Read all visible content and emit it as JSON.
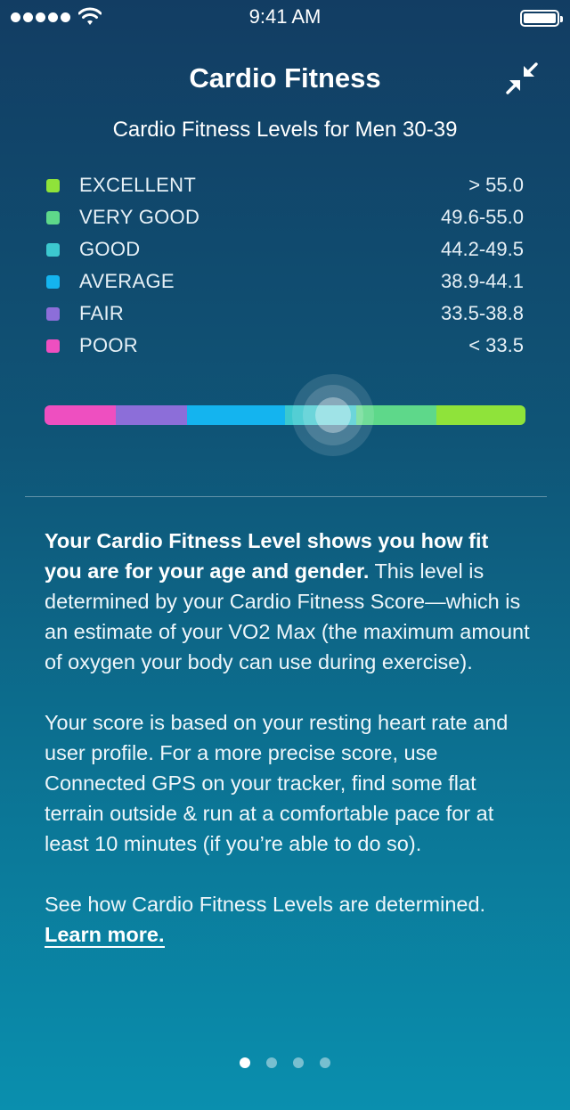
{
  "status_bar": {
    "time": "9:41 AM"
  },
  "header": {
    "title": "Cardio Fitness",
    "subtitle": "Cardio Fitness Levels for Men 30-39"
  },
  "levels": [
    {
      "name": "EXCELLENT",
      "range": "> 55.0",
      "color": "#8fe33a"
    },
    {
      "name": "VERY GOOD",
      "range": "49.6-55.0",
      "color": "#5ed88a"
    },
    {
      "name": "GOOD",
      "range": "44.2-49.5",
      "color": "#3cc8cf"
    },
    {
      "name": "AVERAGE",
      "range": "38.9-44.1",
      "color": "#14b4ef"
    },
    {
      "name": "FAIR",
      "range": "33.5-38.8",
      "color": "#8c6ed9"
    },
    {
      "name": "POOR",
      "range": "< 33.5",
      "color": "#ee4fc0"
    }
  ],
  "meter": {
    "segments": [
      {
        "level": "POOR",
        "color": "#ee4fc0"
      },
      {
        "level": "FAIR",
        "color": "#8c6ed9"
      },
      {
        "level": "AVERAGE",
        "color": "#14b4ef"
      },
      {
        "level": "GOOD",
        "color": "#3cc8cf"
      },
      {
        "level": "VERY GOOD",
        "color": "#5ed88a"
      },
      {
        "level": "EXCELLENT",
        "color": "#8fe33a"
      }
    ],
    "marker_fraction": 0.6
  },
  "description": {
    "p1_bold": "Your Cardio Fitness Level shows you how fit you are for your age and gender.",
    "p1_rest": " This level is determined by your Cardio Fitness Score—which is an estimate of your VO2 Max (the maximum amount of oxygen your body can use during exercise).",
    "p2": "Your score is based on your resting heart rate and user profile. For a more precise score, use Connected GPS on your tracker, find some flat terrain outside & run at a comfortable pace for at least 10 minutes (if you’re able to do so).",
    "p3_prefix": "See how Cardio Fitness Levels are determined. ",
    "learn_more": "Learn more."
  },
  "pager": {
    "pages": 4,
    "active": 0
  }
}
